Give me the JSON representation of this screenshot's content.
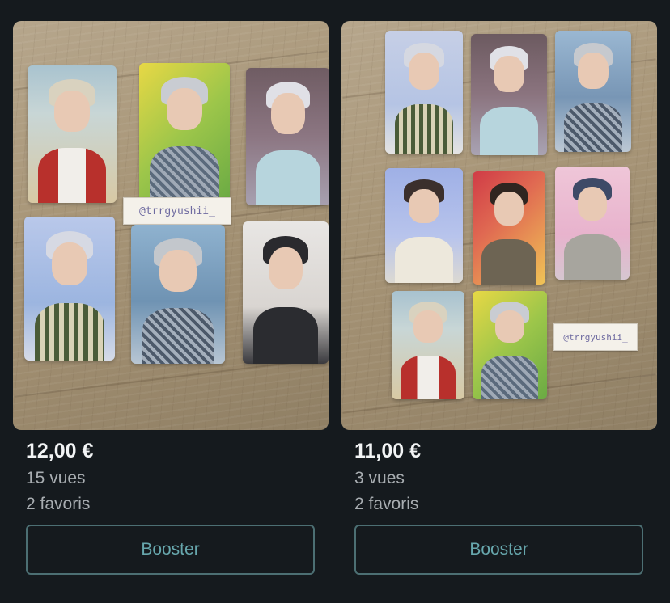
{
  "listings": [
    {
      "price": "12,00 €",
      "views": "15 vues",
      "favorites": "2 favoris",
      "button_label": "Booster",
      "sticky_note": "@trrgyushii_"
    },
    {
      "price": "11,00 €",
      "views": "3 vues",
      "favorites": "2 favoris",
      "button_label": "Booster",
      "sticky_note": "@trrgyushii_"
    }
  ],
  "colors": {
    "background": "#151a1e",
    "price_text": "#f2f4f5",
    "secondary_text": "#a8adb1",
    "button_border": "#4c6f73",
    "button_text": "#67a7ad"
  }
}
